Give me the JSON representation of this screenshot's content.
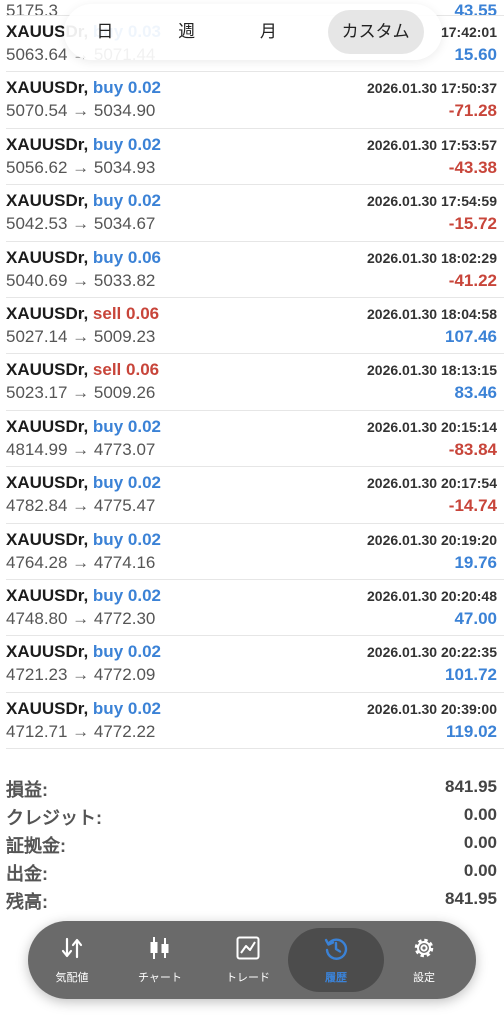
{
  "period_tabs": [
    {
      "label": "日",
      "active": false
    },
    {
      "label": "週",
      "active": false
    },
    {
      "label": "月",
      "active": false
    },
    {
      "label": "カスタム",
      "active": true
    }
  ],
  "partial_top": {
    "prices": "5175.3",
    "profit": "43.55"
  },
  "trades": [
    {
      "symbol": "XAUUSDr,",
      "side": "buy",
      "volume": "0.03",
      "time": "17:42:01",
      "prices": "5063.64 → 5071.44",
      "profit": "15.60"
    },
    {
      "symbol": "XAUUSDr,",
      "side": "buy",
      "volume": "0.02",
      "time": "2026.01.30 17:50:37",
      "prices": "5070.54 → 5034.90",
      "profit": "-71.28"
    },
    {
      "symbol": "XAUUSDr,",
      "side": "buy",
      "volume": "0.02",
      "time": "2026.01.30 17:53:57",
      "prices": "5056.62 → 5034.93",
      "profit": "-43.38"
    },
    {
      "symbol": "XAUUSDr,",
      "side": "buy",
      "volume": "0.02",
      "time": "2026.01.30 17:54:59",
      "prices": "5042.53 → 5034.67",
      "profit": "-15.72"
    },
    {
      "symbol": "XAUUSDr,",
      "side": "buy",
      "volume": "0.06",
      "time": "2026.01.30 18:02:29",
      "prices": "5040.69 → 5033.82",
      "profit": "-41.22"
    },
    {
      "symbol": "XAUUSDr,",
      "side": "sell",
      "volume": "0.06",
      "time": "2026.01.30 18:04:58",
      "prices": "5027.14 → 5009.23",
      "profit": "107.46"
    },
    {
      "symbol": "XAUUSDr,",
      "side": "sell",
      "volume": "0.06",
      "time": "2026.01.30 18:13:15",
      "prices": "5023.17 → 5009.26",
      "profit": "83.46"
    },
    {
      "symbol": "XAUUSDr,",
      "side": "buy",
      "volume": "0.02",
      "time": "2026.01.30 20:15:14",
      "prices": "4814.99 → 4773.07",
      "profit": "-83.84"
    },
    {
      "symbol": "XAUUSDr,",
      "side": "buy",
      "volume": "0.02",
      "time": "2026.01.30 20:17:54",
      "prices": "4782.84 → 4775.47",
      "profit": "-14.74"
    },
    {
      "symbol": "XAUUSDr,",
      "side": "buy",
      "volume": "0.02",
      "time": "2026.01.30 20:19:20",
      "prices": "4764.28 → 4774.16",
      "profit": "19.76"
    },
    {
      "symbol": "XAUUSDr,",
      "side": "buy",
      "volume": "0.02",
      "time": "2026.01.30 20:20:48",
      "prices": "4748.80 → 4772.30",
      "profit": "47.00"
    },
    {
      "symbol": "XAUUSDr,",
      "side": "buy",
      "volume": "0.02",
      "time": "2026.01.30 20:22:35",
      "prices": "4721.23 → 4772.09",
      "profit": "101.72"
    },
    {
      "symbol": "XAUUSDr,",
      "side": "buy",
      "volume": "0.02",
      "time": "2026.01.30 20:39:00",
      "prices": "4712.71 → 4772.22",
      "profit": "119.02"
    }
  ],
  "summary": [
    {
      "label": "損益:",
      "value": "841.95"
    },
    {
      "label": "クレジット:",
      "value": "0.00"
    },
    {
      "label": "証拠金:",
      "value": "0.00"
    },
    {
      "label": "出金:",
      "value": "0.00"
    },
    {
      "label": "残高:",
      "value": "841.95"
    }
  ],
  "nav": [
    {
      "label": "気配値",
      "icon": "quotes-arrows-icon",
      "active": false
    },
    {
      "label": "チャート",
      "icon": "candlestick-chart-icon",
      "active": false
    },
    {
      "label": "トレード",
      "icon": "trade-chart-icon",
      "active": false
    },
    {
      "label": "履歴",
      "icon": "history-clock-icon",
      "active": true
    },
    {
      "label": "設定",
      "icon": "gear-icon",
      "active": false
    }
  ],
  "colors": {
    "positive": "#3b82d6",
    "negative": "#c8453a",
    "nav_bg": "#6a6a6a"
  }
}
